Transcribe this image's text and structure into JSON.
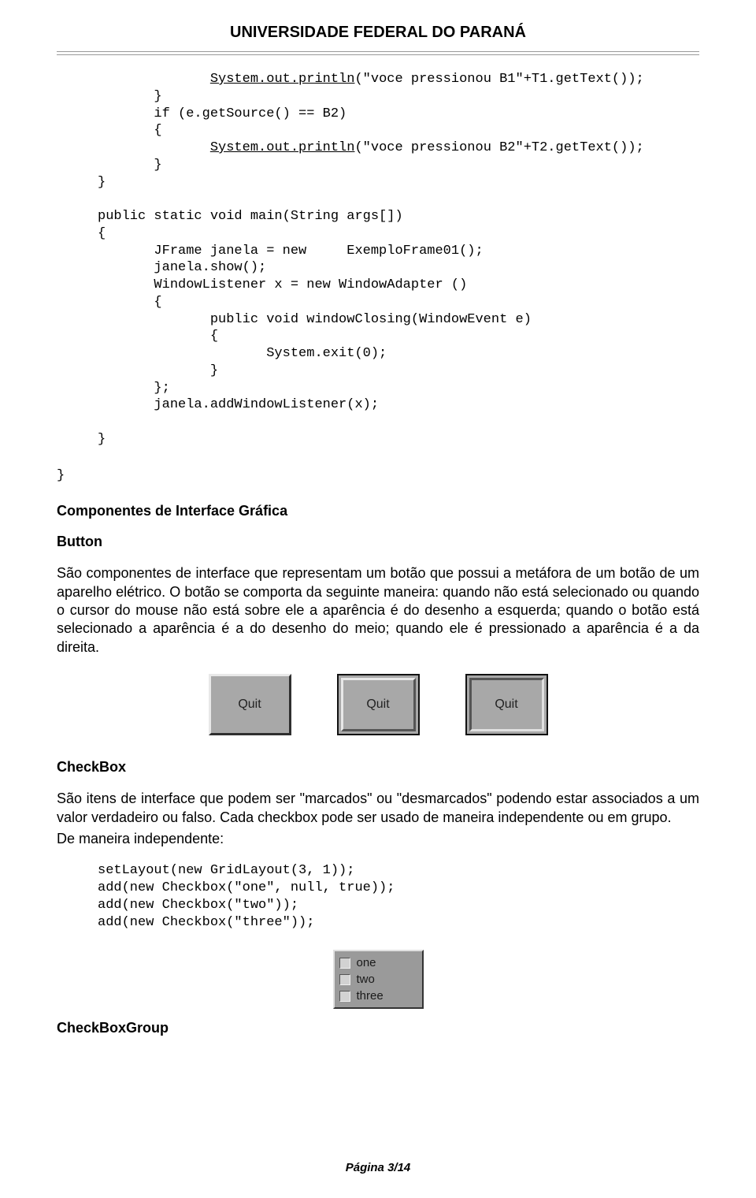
{
  "header": {
    "title": "UNIVERSIDADE FEDERAL DO PARANÁ"
  },
  "code_block_1": {
    "l1a": "              ",
    "l1_u": "System.out.println",
    "l1b": "(\"voce pressionou B1\"+T1.getText());",
    "l2": "       }",
    "l3": "       if (e.getSource() == B2)",
    "l4": "       {",
    "l5a": "              ",
    "l5_u": "System.out.println",
    "l5b": "(\"voce pressionou B2\"+T2.getText());",
    "l6": "       }",
    "l7": "}",
    "blank1": "",
    "l8": "public static void main(String args[])",
    "l9": "{",
    "l10": "       JFrame janela = new     ExemploFrame01();",
    "l11": "       janela.show();",
    "l12": "       WindowListener x = new WindowAdapter ()",
    "l13": "       {",
    "l14": "              public void windowClosing(WindowEvent e)",
    "l15": "              {",
    "l16": "                     System.exit(0);",
    "l17": "              }",
    "l18": "       };",
    "l19": "       janela.addWindowListener(x);",
    "blank2": "",
    "l20": "}"
  },
  "close_brace_outer": "}",
  "sections": {
    "componentes_title": "Componentes de Interface Gráfica",
    "button_title": "Button",
    "button_paragraph": "São componentes de interface que representam um botão que possui a metáfora de um botão de um aparelho elétrico. O botão se comporta da seguinte maneira: quando não está selecionado ou quando o cursor do mouse não está sobre ele a aparência é do desenho a esquerda; quando o botão está selecionado a aparência é a do desenho do meio; quando ele é pressionado a aparência é a da direita.",
    "quit_label": "Quit",
    "checkbox_title": "CheckBox",
    "checkbox_paragraph": "São itens de interface que podem ser \"marcados\" ou \"desmarcados\"  podendo estar associados a um valor verdadeiro ou falso. Cada checkbox pode ser usado de maneira independente ou em grupo.",
    "checkbox_independent": "De maneira independente:",
    "checkboxgroup_title": "CheckBoxGroup"
  },
  "code_block_2": {
    "l1": "setLayout(new GridLayout(3, 1));",
    "l2": "add(new Checkbox(\"one\", null, true));",
    "l3": "add(new Checkbox(\"two\"));",
    "l4": "add(new Checkbox(\"three\"));"
  },
  "checkbox_items": {
    "one": "one",
    "two": "two",
    "three": "three"
  },
  "footer": {
    "text": "Página 3/14"
  }
}
